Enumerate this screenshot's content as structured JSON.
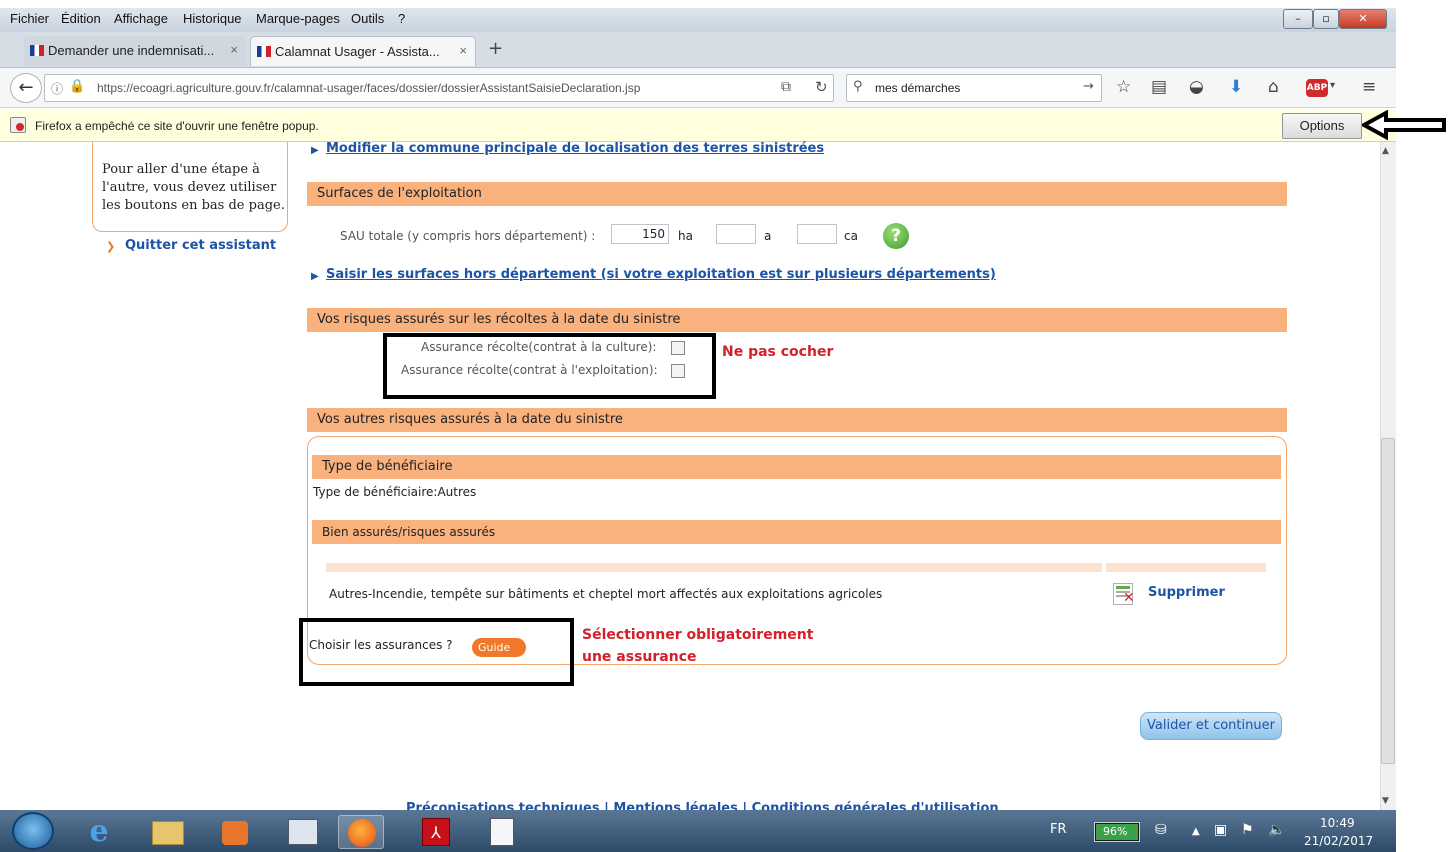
{
  "menubar": [
    "Fichier",
    "Édition",
    "Affichage",
    "Historique",
    "Marque-pages",
    "Outils",
    "?"
  ],
  "tabs": [
    {
      "label": "Demander une indemnisati...",
      "active": false
    },
    {
      "label": "Calamnat Usager - Assista...",
      "active": true
    }
  ],
  "url": "https://ecoagri.agriculture.gouv.fr/calamnat-usager/faces/dossier/dossierAssistantSaisieDeclaration.jsp",
  "search_text": "mes démarches",
  "notification": {
    "text": "Firefox a empêché ce site d'ouvrir une fenêtre popup.",
    "button": "Options"
  },
  "sidebar": {
    "help_text": "Pour aller d'une étape à l'autre, vous devez utiliser les boutons en bas de page.",
    "quit_link": "Quitter cet assistant"
  },
  "links": {
    "modify_commune": "Modifier la commune principale de localisation des terres sinistrées",
    "surfaces_hors_dept": "Saisir les surfaces hors département (si votre exploitation est sur plusieurs départements)"
  },
  "surfaces": {
    "header": "Surfaces de l'exploitation",
    "sau_label": "SAU totale (y compris hors département) :",
    "ha_value": "150",
    "unit_ha": "ha",
    "unit_a": "a",
    "unit_ca": "ca"
  },
  "risques": {
    "header": "Vos risques assurés sur les récoltes à la date du sinistre",
    "cb1_label": "Assurance récolte(contrat à la culture):",
    "cb2_label": "Assurance récolte(contrat à l'exploitation):",
    "note": "Ne pas cocher"
  },
  "autres_risques": {
    "header": "Vos autres risques assurés à la date du sinistre",
    "beneficiaire_header": "Type de bénéficiaire",
    "beneficiaire_text": "Type de bénéficiaire:Autres",
    "biens_header": "Bien assurés/risques assurés",
    "row_text": "Autres-Incendie, tempête sur bâtiments et cheptel mort affectés aux exploitations agricoles",
    "delete_label": "Supprimer",
    "choose_label": "Choisir les assurances ?",
    "guide_label": "Guide",
    "note_line1": "Sélectionner obligatoirement",
    "note_line2": "une assurance"
  },
  "submit_label": "Valider et continuer",
  "footer_links": "Préconisations techniques | Mentions légales | Conditions générales d'utilisation",
  "taskbar": {
    "lang": "FR",
    "battery": "96%",
    "time": "10:49",
    "date": "21/02/2017"
  },
  "colors": {
    "orange_header": "#f9b27e",
    "link_blue": "#1d54a6",
    "red_note": "#d4202a",
    "button_blue": "#5aa0d6"
  }
}
